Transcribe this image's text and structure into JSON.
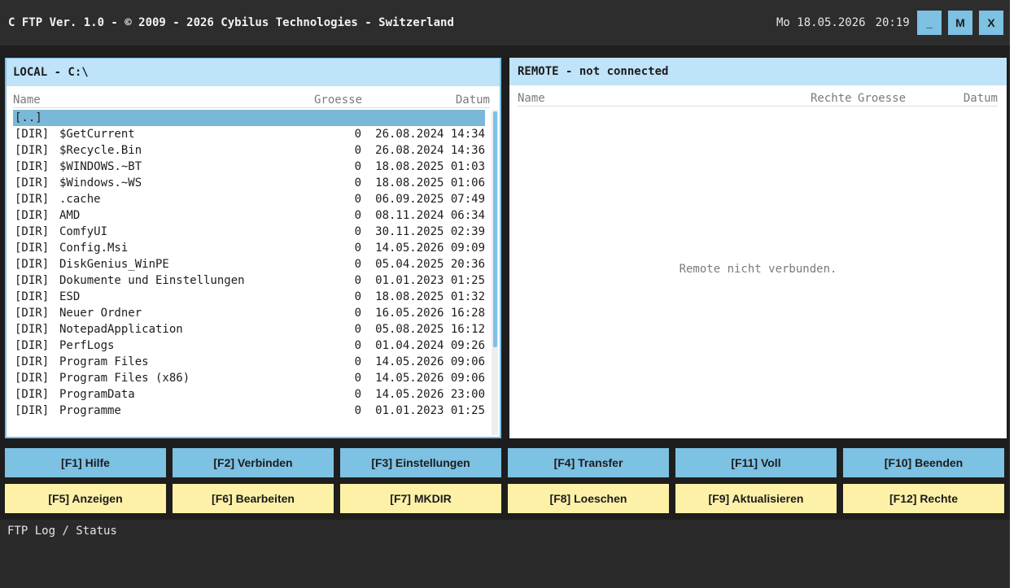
{
  "titlebar": {
    "title": "C FTP Ver. 1.0 - © 2009 - 2026 Cybilus Technologies - Switzerland",
    "date": "Mo 18.05.2026",
    "time": "20:19",
    "minimize_label": "_",
    "maximize_label": "M",
    "close_label": "X"
  },
  "local": {
    "title": "LOCAL - C:\\",
    "columns": {
      "name": "Name",
      "size": "Groesse",
      "date": "Datum"
    },
    "parent": "[..]",
    "rows": [
      {
        "type": "[DIR]",
        "name": "$GetCurrent",
        "size": "0",
        "date": "26.08.2024 14:34"
      },
      {
        "type": "[DIR]",
        "name": "$Recycle.Bin",
        "size": "0",
        "date": "26.08.2024 14:36"
      },
      {
        "type": "[DIR]",
        "name": "$WINDOWS.~BT",
        "size": "0",
        "date": "18.08.2025 01:03"
      },
      {
        "type": "[DIR]",
        "name": "$Windows.~WS",
        "size": "0",
        "date": "18.08.2025 01:06"
      },
      {
        "type": "[DIR]",
        "name": ".cache",
        "size": "0",
        "date": "06.09.2025 07:49"
      },
      {
        "type": "[DIR]",
        "name": "AMD",
        "size": "0",
        "date": "08.11.2024 06:34"
      },
      {
        "type": "[DIR]",
        "name": "ComfyUI",
        "size": "0",
        "date": "30.11.2025 02:39"
      },
      {
        "type": "[DIR]",
        "name": "Config.Msi",
        "size": "0",
        "date": "14.05.2026 09:09"
      },
      {
        "type": "[DIR]",
        "name": "DiskGenius_WinPE",
        "size": "0",
        "date": "05.04.2025 20:36"
      },
      {
        "type": "[DIR]",
        "name": "Dokumente und Einstellungen",
        "size": "0",
        "date": "01.01.2023 01:25"
      },
      {
        "type": "[DIR]",
        "name": "ESD",
        "size": "0",
        "date": "18.08.2025 01:32"
      },
      {
        "type": "[DIR]",
        "name": "Neuer Ordner",
        "size": "0",
        "date": "16.05.2026 16:28"
      },
      {
        "type": "[DIR]",
        "name": "NotepadApplication",
        "size": "0",
        "date": "05.08.2025 16:12"
      },
      {
        "type": "[DIR]",
        "name": "PerfLogs",
        "size": "0",
        "date": "01.04.2024 09:26"
      },
      {
        "type": "[DIR]",
        "name": "Program Files",
        "size": "0",
        "date": "14.05.2026 09:06"
      },
      {
        "type": "[DIR]",
        "name": "Program Files (x86)",
        "size": "0",
        "date": "14.05.2026 09:06"
      },
      {
        "type": "[DIR]",
        "name": "ProgramData",
        "size": "0",
        "date": "14.05.2026 23:00"
      },
      {
        "type": "[DIR]",
        "name": "Programme",
        "size": "0",
        "date": "01.01.2023 01:25"
      }
    ]
  },
  "remote": {
    "title": "REMOTE - not connected",
    "columns": {
      "name": "Name",
      "rights": "Rechte",
      "size": "Groesse",
      "date": "Datum"
    },
    "message": "Remote nicht verbunden."
  },
  "fkeys": {
    "f1": "[F1] Hilfe",
    "f2": "[F2] Verbinden",
    "f3": "[F3] Einstellungen",
    "f4": "[F4] Transfer",
    "f11": "[F11] Voll",
    "f10": "[F10] Beenden",
    "f5": "[F5] Anzeigen",
    "f6": "[F6] Bearbeiten",
    "f7": "[F7] MKDIR",
    "f8": "[F8] Loeschen",
    "f9": "[F9] Aktualisieren",
    "f12": "[F12] Rechte"
  },
  "log": {
    "title": "FTP Log / Status"
  }
}
